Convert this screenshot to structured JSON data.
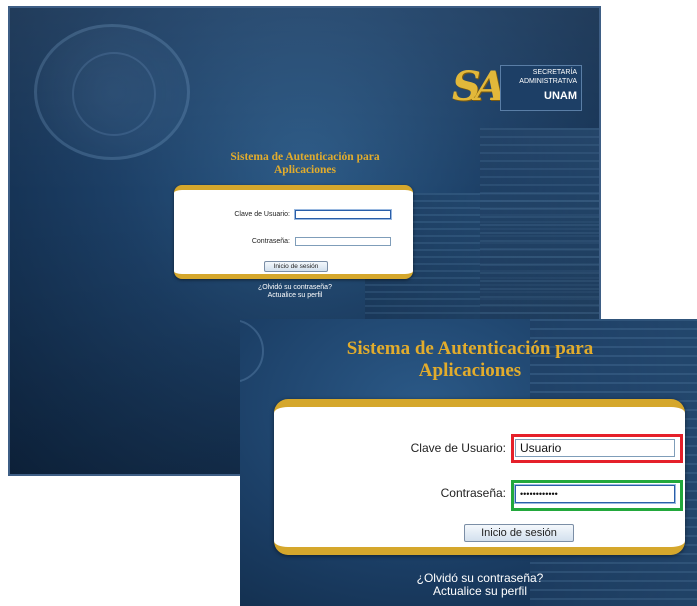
{
  "app": {
    "title_line1": "Sistema de Autenticación para",
    "title_line2": "Aplicaciones"
  },
  "logo": {
    "letters": "SA",
    "line1": "SECRETARÍA",
    "line2": "ADMINISTRATIVA",
    "line3": "UNAM"
  },
  "login": {
    "user_label": "Clave de Usuario:",
    "user_value": "",
    "password_label": "Contraseña:",
    "password_value": "",
    "submit_label": "Inicio de sesión",
    "forgot_line1": "¿Olvidó su contraseña?",
    "forgot_line2": "Actualice su perfil"
  },
  "zoom": {
    "user_value": "Usuario",
    "password_mask": "••••••••••••"
  },
  "colors": {
    "accent_gold": "#d5a72c",
    "title_gold": "#e2ac2c",
    "background_blue": "#1c3f66",
    "highlight_user": "#e5202a",
    "highlight_password": "#22a83c"
  },
  "icons": {
    "seal": "unam-seal-icon",
    "logo": "sa-logo-icon"
  }
}
